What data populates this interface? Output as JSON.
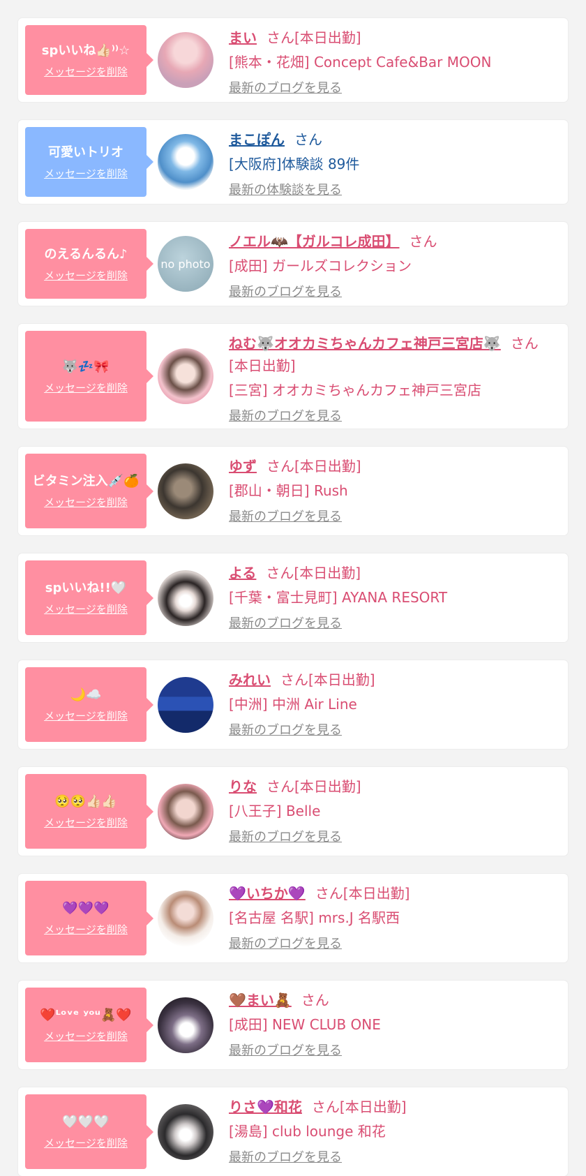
{
  "colors": {
    "pink_bubble": "#ff8fa1",
    "blue_bubble": "#8ab8ff",
    "pink_text": "#d94d72",
    "blue_text": "#1f5a9c",
    "link_gray": "#8a8a8a",
    "page_bg": "#f3f3f3"
  },
  "delete_label": "メッセージを削除",
  "cards": [
    {
      "message": "spいいね👍🏻⁾⁾☆",
      "name": "まい",
      "suffix": "さん[本日出勤]",
      "shop": "[熊本・花畑] Concept Cafe&Bar MOON",
      "link": "最新のブログを見る",
      "bubble": "pink",
      "avatar": "photo-1"
    },
    {
      "message": "可愛いトリオ",
      "name": "まこぽん",
      "suffix": "さん",
      "shop": "[大阪府]体験談 89件",
      "link": "最新の体験談を見る",
      "bubble": "blue",
      "avatar": "penguin-plush"
    },
    {
      "message": "のえるんるん♪",
      "name": "ノエル🦇【ガルコレ成田】",
      "suffix": "さん",
      "shop": "[成田] ガールズコレクション",
      "link": "最新のブログを見る",
      "bubble": "pink",
      "avatar": "no-photo",
      "nophoto_text": "no photo"
    },
    {
      "message": "🐺💤🎀",
      "name": "ねむ🐺オオカミちゃんカフェ神戸三宮店🐺",
      "suffix": "さん[本日出勤]",
      "shop": "[三宮] オオカミちゃんカフェ神戸三宮店",
      "link": "最新のブログを見る",
      "bubble": "pink",
      "avatar": "photo-3"
    },
    {
      "message": "ビタミン注入💉🍊",
      "name": "ゆず",
      "suffix": "さん[本日出勤]",
      "shop": "[郡山・朝日] Rush",
      "link": "最新のブログを見る",
      "bubble": "pink",
      "avatar": "photo-4"
    },
    {
      "message": "spいいね!!🤍",
      "name": "よる",
      "suffix": "さん[本日出勤]",
      "shop": "[千葉・富士見町] AYANA RESORT",
      "link": "最新のブログを見る",
      "bubble": "pink",
      "avatar": "photo-5"
    },
    {
      "message": "🌙☁️",
      "name": "みれい",
      "suffix": "さん[本日出勤]",
      "shop": "[中洲] 中洲 Air Line",
      "link": "最新のブログを見る",
      "bubble": "pink",
      "avatar": "photo-6"
    },
    {
      "message": "🥺🥺👍🏻👍🏻",
      "name": "りな",
      "suffix": "さん[本日出勤]",
      "shop": "[八王子] Belle",
      "link": "最新のブログを見る",
      "bubble": "pink",
      "avatar": "photo-7"
    },
    {
      "message": "💜💜💜",
      "name": "💜いちか💜",
      "suffix": "さん[本日出勤]",
      "shop": "[名古屋 名駅] mrs.J 名駅西",
      "link": "最新のブログを見る",
      "bubble": "pink",
      "avatar": "photo-8"
    },
    {
      "message": "❤️ᴸᵒᵛᵉ ʸᵒᵘ🧸❤️",
      "name": "🤎まい🧸",
      "suffix": "さん",
      "shop": "[成田] NEW CLUB ONE",
      "link": "最新のブログを見る",
      "bubble": "pink",
      "avatar": "photo-9"
    },
    {
      "message": "🤍🤍🤍",
      "name": "りさ💜和花",
      "suffix": "さん[本日出勤]",
      "shop": "[湯島] club lounge 和花",
      "link": "最新のブログを見る",
      "bubble": "pink",
      "avatar": "photo-10"
    }
  ]
}
